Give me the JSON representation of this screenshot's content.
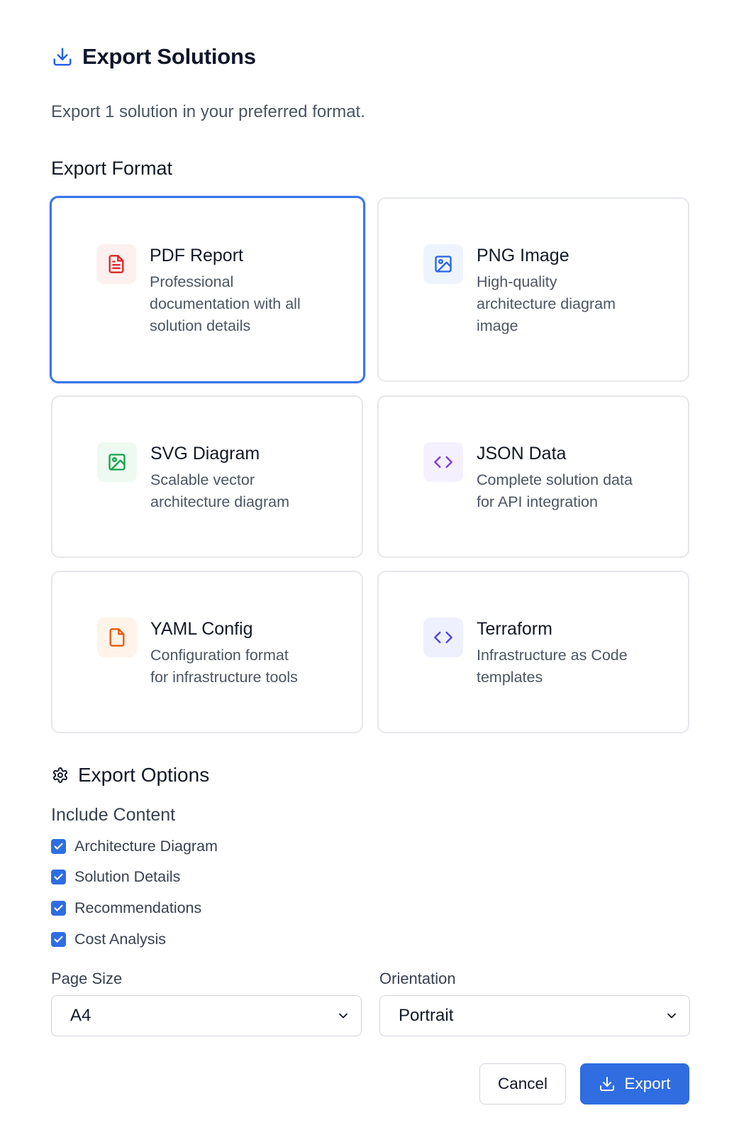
{
  "dialog": {
    "title": "Export Solutions",
    "subtitle": "Export 1 solution in your preferred format.",
    "title_icon": "download-icon"
  },
  "format_section": {
    "label": "Export Format",
    "selected": "pdf",
    "formats": [
      {
        "id": "pdf",
        "name": "PDF Report",
        "desc_lines": [
          "Professional",
          "documentation with all",
          "solution details"
        ],
        "icon": "file-text-icon",
        "accent": "#dc2626",
        "icon_bg": "#fdf0ef"
      },
      {
        "id": "png",
        "name": "PNG Image",
        "desc_lines": [
          "High-quality",
          "architecture diagram",
          "image"
        ],
        "icon": "image-icon",
        "accent": "#2563eb",
        "icon_bg": "#eef4fe"
      },
      {
        "id": "svg",
        "name": "SVG Diagram",
        "desc_lines": [
          "Scalable vector",
          "architecture diagram"
        ],
        "icon": "image-icon",
        "accent": "#16a34a",
        "icon_bg": "#eefaf1"
      },
      {
        "id": "json",
        "name": "JSON Data",
        "desc_lines": [
          "Complete solution data",
          "for API integration"
        ],
        "icon": "code-icon",
        "accent": "#7c3aed",
        "icon_bg": "#f5f0fe"
      },
      {
        "id": "yaml",
        "name": "YAML Config",
        "desc_lines": [
          "Configuration format",
          "for infrastructure tools"
        ],
        "icon": "file-icon",
        "accent": "#ea580c",
        "icon_bg": "#fff3ea"
      },
      {
        "id": "terraform",
        "name": "Terraform",
        "desc_lines": [
          "Infrastructure as Code",
          "templates"
        ],
        "icon": "code-icon",
        "accent": "#4f46e5",
        "icon_bg": "#eef0fe"
      }
    ]
  },
  "options": {
    "title": "Export Options",
    "title_icon": "gear-icon",
    "include_label": "Include Content",
    "checkboxes": [
      {
        "label": "Architecture Diagram",
        "checked": true
      },
      {
        "label": "Solution Details",
        "checked": true
      },
      {
        "label": "Recommendations",
        "checked": true
      },
      {
        "label": "Cost Analysis",
        "checked": true
      }
    ],
    "page_size": {
      "label": "Page Size",
      "value": "A4"
    },
    "orientation": {
      "label": "Orientation",
      "value": "Portrait"
    }
  },
  "actions": {
    "cancel_label": "Cancel",
    "export_label": "Export"
  },
  "colors": {
    "primary": "#2f6de0",
    "selected_border": "#3b74e8"
  }
}
